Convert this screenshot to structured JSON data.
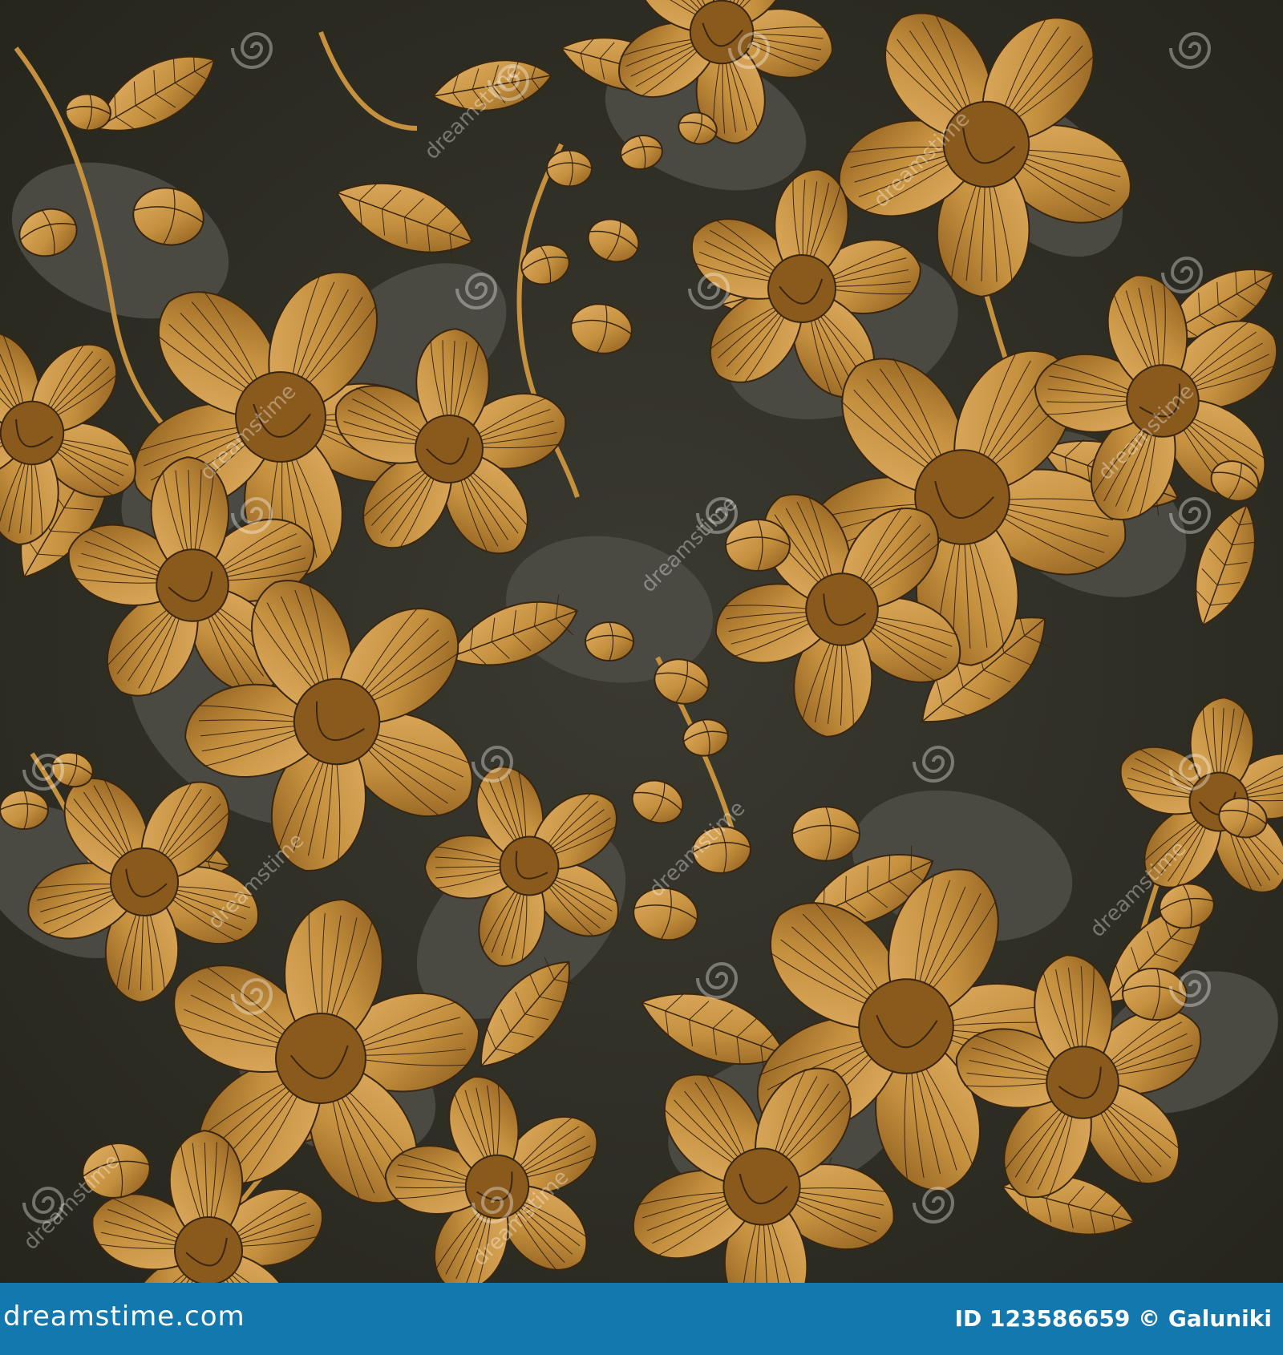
{
  "colors": {
    "background": "#3b3a30",
    "shadow": "#4a4a42",
    "gold_light": "#e2b067",
    "gold_mid": "#c5913f",
    "gold_dark": "#8a5a1c",
    "outline": "#3a2610",
    "footer_bar": "#1378ad"
  },
  "watermark": {
    "text": "dreamstime"
  },
  "footer": {
    "logo": "dreamstime.com",
    "credit": "ID 123586659 © Galuniki"
  }
}
